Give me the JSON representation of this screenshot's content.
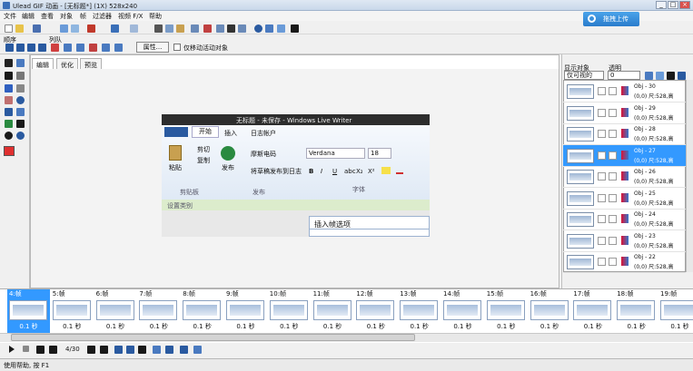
{
  "window": {
    "title": "Ulead GIF 动画 - [无标题*] (1X) 528x240",
    "controls": [
      "_",
      "□",
      "×"
    ]
  },
  "menu": [
    "文件",
    "编辑",
    "查看",
    "对象",
    "帧",
    "过滤器",
    "视频 F/X",
    "帮助"
  ],
  "upload_button": "拖拽上传",
  "toolbar2": {
    "order_label": "顺序",
    "align_label": "列队",
    "properties_button": "属性...",
    "checkbox_label": "仅移动活动对象"
  },
  "tabs": [
    "编辑",
    "优化",
    "预览"
  ],
  "canvas": {
    "window_title": "无标题 - 未保存 - Windows Live Writer",
    "ribbon_tabs": [
      "开始",
      "插入",
      "日志帐户"
    ],
    "clipboard": {
      "paste": "粘贴",
      "cut": "剪切",
      "copy": "复制",
      "group": "剪贴板"
    },
    "publish": {
      "publish": "发布",
      "item1": "摩斯电码",
      "item2": "将草稿发布到日志",
      "group": "发布"
    },
    "font": {
      "name": "Verdana",
      "size": "18",
      "group": "字体",
      "buttons": [
        "B",
        "I",
        "U",
        "abc",
        "X₂",
        "X²"
      ]
    },
    "bar_label": "设置类别",
    "dialog_title": "插入帧选项"
  },
  "right_panel": {
    "display_label": "显示对象",
    "display_value": "仅可视的",
    "opacity_label": "透明",
    "opacity_value": "0"
  },
  "objects": [
    {
      "name": "Obj - 30",
      "coord": "(0,0) 尺:528,高"
    },
    {
      "name": "Obj - 29",
      "coord": "(0,0) 尺:528,高"
    },
    {
      "name": "Obj - 28",
      "coord": "(0,0) 尺:528,高"
    },
    {
      "name": "Obj - 27",
      "coord": "(0,0) 尺:528,高",
      "selected": true
    },
    {
      "name": "Obj - 26",
      "coord": "(0,0) 尺:528,高"
    },
    {
      "name": "Obj - 25",
      "coord": "(0,0) 尺:528,高"
    },
    {
      "name": "Obj - 24",
      "coord": "(0,0) 尺:528,高"
    },
    {
      "name": "Obj - 23",
      "coord": "(0,0) 尺:528,高"
    },
    {
      "name": "Obj - 22",
      "coord": "(0,0) 尺:528,高"
    }
  ],
  "frames": [
    {
      "label": "4:帧",
      "delay": "0.1 秒",
      "selected": true
    },
    {
      "label": "5:帧",
      "delay": "0.1 秒"
    },
    {
      "label": "6:帧",
      "delay": "0.1 秒"
    },
    {
      "label": "7:帧",
      "delay": "0.1 秒"
    },
    {
      "label": "8:帧",
      "delay": "0.1 秒"
    },
    {
      "label": "9:帧",
      "delay": "0.1 秒"
    },
    {
      "label": "10:帧",
      "delay": "0.1 秒"
    },
    {
      "label": "11:帧",
      "delay": "0.1 秒"
    },
    {
      "label": "12:帧",
      "delay": "0.1 秒"
    },
    {
      "label": "13:帧",
      "delay": "0.1 秒"
    },
    {
      "label": "14:帧",
      "delay": "0.1 秒"
    },
    {
      "label": "15:帧",
      "delay": "0.1 秒"
    },
    {
      "label": "16:帧",
      "delay": "0.1 秒"
    },
    {
      "label": "17:帧",
      "delay": "0.1 秒"
    },
    {
      "label": "18:帧",
      "delay": "0.1 秒"
    },
    {
      "label": "19:帧",
      "delay": "0.1 秒"
    }
  ],
  "playback": {
    "frame_counter": "4/30"
  },
  "status": "使用帮助, 按 F1",
  "colors": {
    "accent": "#3399ff",
    "selected_row": "#3399ff",
    "fg_color": "#e03030",
    "bg_color": "#7a7a7a"
  }
}
